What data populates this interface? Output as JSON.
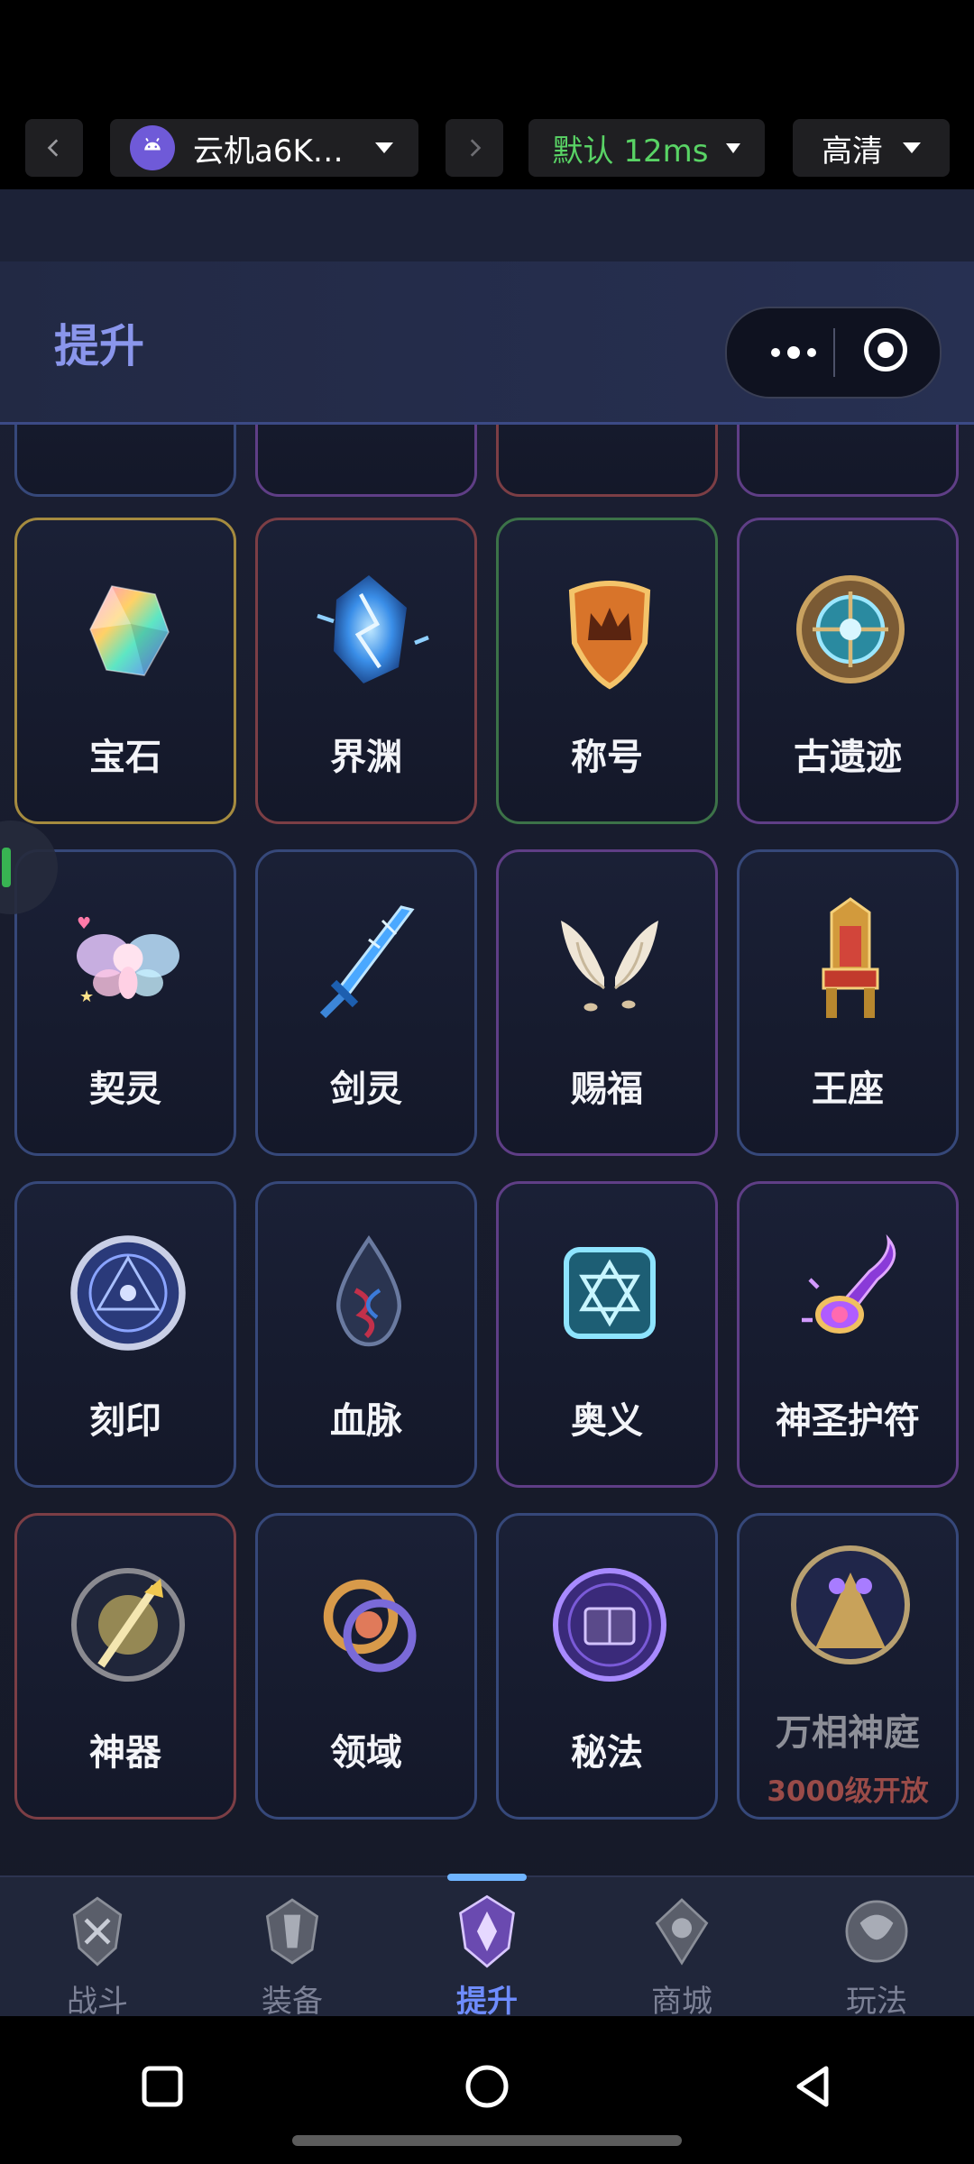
{
  "topbar": {
    "device_label": "云机a6K…",
    "latency_label": "默认 12ms",
    "quality_label": "高清",
    "icons": [
      "chevron-left-icon",
      "android-icon",
      "caret-down-icon",
      "chevron-right-icon"
    ]
  },
  "header": {
    "title": "提升"
  },
  "cards": {
    "row1": [
      {
        "name": "宝石",
        "icon": "gem-icon",
        "color": "#a58b3f"
      },
      {
        "name": "界渊",
        "icon": "lightning-crystal-icon",
        "color": "#7c3e45"
      },
      {
        "name": "称号",
        "icon": "crown-shield-icon",
        "color": "#3c7248"
      },
      {
        "name": "古遗迹",
        "icon": "relic-disc-icon",
        "color": "#5f3e86"
      }
    ],
    "row2": [
      {
        "name": "契灵",
        "icon": "fairy-icon"
      },
      {
        "name": "剑灵",
        "icon": "sword-icon"
      },
      {
        "name": "赐福",
        "icon": "wings-icon"
      },
      {
        "name": "王座",
        "icon": "throne-icon"
      }
    ],
    "row3": [
      {
        "name": "刻印",
        "icon": "rune-circle-icon"
      },
      {
        "name": "血脉",
        "icon": "blood-drop-icon"
      },
      {
        "name": "奥义",
        "icon": "hexagram-icon"
      },
      {
        "name": "神圣护符",
        "icon": "amulet-icon"
      }
    ],
    "row4": [
      {
        "name": "神器",
        "icon": "artifact-icon"
      },
      {
        "name": "领域",
        "icon": "domain-rings-icon"
      },
      {
        "name": "秘法",
        "icon": "spellbook-icon"
      },
      {
        "name": "万相神庭",
        "icon": "temple-icon",
        "unlock_text": "3000级开放"
      }
    ]
  },
  "tabs": [
    {
      "label": "战斗",
      "icon": "battle-icon",
      "active": false
    },
    {
      "label": "装备",
      "icon": "equipment-icon",
      "active": false
    },
    {
      "label": "提升",
      "icon": "upgrade-icon",
      "active": true
    },
    {
      "label": "商城",
      "icon": "shop-icon",
      "active": false
    },
    {
      "label": "玩法",
      "icon": "gameplay-icon",
      "active": false
    }
  ],
  "colors": {
    "title": "#8a96ec",
    "active_tab": "#6e8cff",
    "latency": "#59d365",
    "locked_text": "#9a4b48"
  }
}
